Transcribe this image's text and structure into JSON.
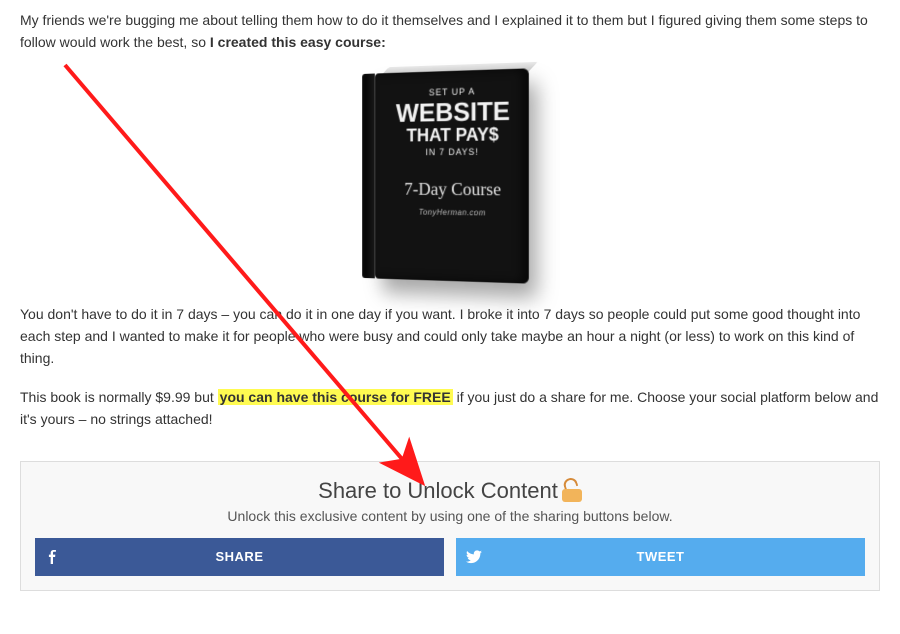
{
  "para1": {
    "pre": "My friends we're bugging me about telling them how to do it themselves and I explained it to them but I figured giving them some steps to follow would work the best, so ",
    "bold": "I created this easy course:"
  },
  "book": {
    "line1": "SET UP A",
    "line2": "WEBSITE",
    "line3": "THAT PAY$",
    "line4": "IN 7 DAYS!",
    "course": "7-Day Course",
    "author": "TonyHerman.com"
  },
  "para2": "You don't have to do it in 7 days – you can do it in one day if you want. I broke it into 7 days so people could put some good thought into each step and I wanted to make it for people who were busy and could only take maybe an hour a night (or less) to work on this kind of thing.",
  "para3": {
    "pre": "This book is normally $9.99 but ",
    "hl": "you can have this course for FREE",
    "post": " if you just do a share for me. Choose your social platform below and it's yours – no strings attached!"
  },
  "share": {
    "title": "Share to Unlock Content",
    "sub": "Unlock this exclusive content by using one of the sharing buttons below.",
    "fb": "SHARE",
    "tw": "TWEET"
  }
}
